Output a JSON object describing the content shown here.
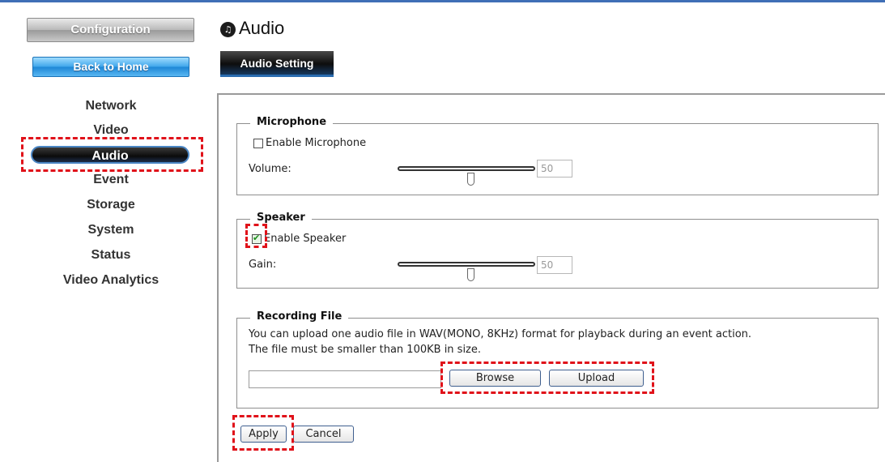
{
  "sidebar": {
    "config_label": "Configuration",
    "home_label": "Back to Home",
    "items": [
      {
        "label": "Network"
      },
      {
        "label": "Video"
      },
      {
        "label": "Audio"
      },
      {
        "label": "Event"
      },
      {
        "label": "Storage"
      },
      {
        "label": "System"
      },
      {
        "label": "Status"
      },
      {
        "label": "Video Analytics"
      }
    ],
    "active_item": "Audio"
  },
  "header": {
    "title": "Audio",
    "tab_label": "Audio Setting"
  },
  "microphone": {
    "legend": "Microphone",
    "enable_label": "Enable Microphone",
    "enabled": false,
    "volume_label": "Volume:",
    "volume_value": "50"
  },
  "speaker": {
    "legend": "Speaker",
    "enable_label": "Enable Speaker",
    "enabled": true,
    "gain_label": "Gain:",
    "gain_value": "50"
  },
  "recording": {
    "legend": "Recording File",
    "desc_line1": "You can upload one audio file in WAV(MONO, 8KHz) format for playback during an event action.",
    "desc_line2": "The file must be smaller than 100KB in size.",
    "file_value": "",
    "browse_label": "Browse",
    "upload_label": "Upload"
  },
  "actions": {
    "apply_label": "Apply",
    "cancel_label": "Cancel"
  },
  "colors": {
    "highlight": "#e0121a",
    "accent": "#2a6cb0"
  }
}
